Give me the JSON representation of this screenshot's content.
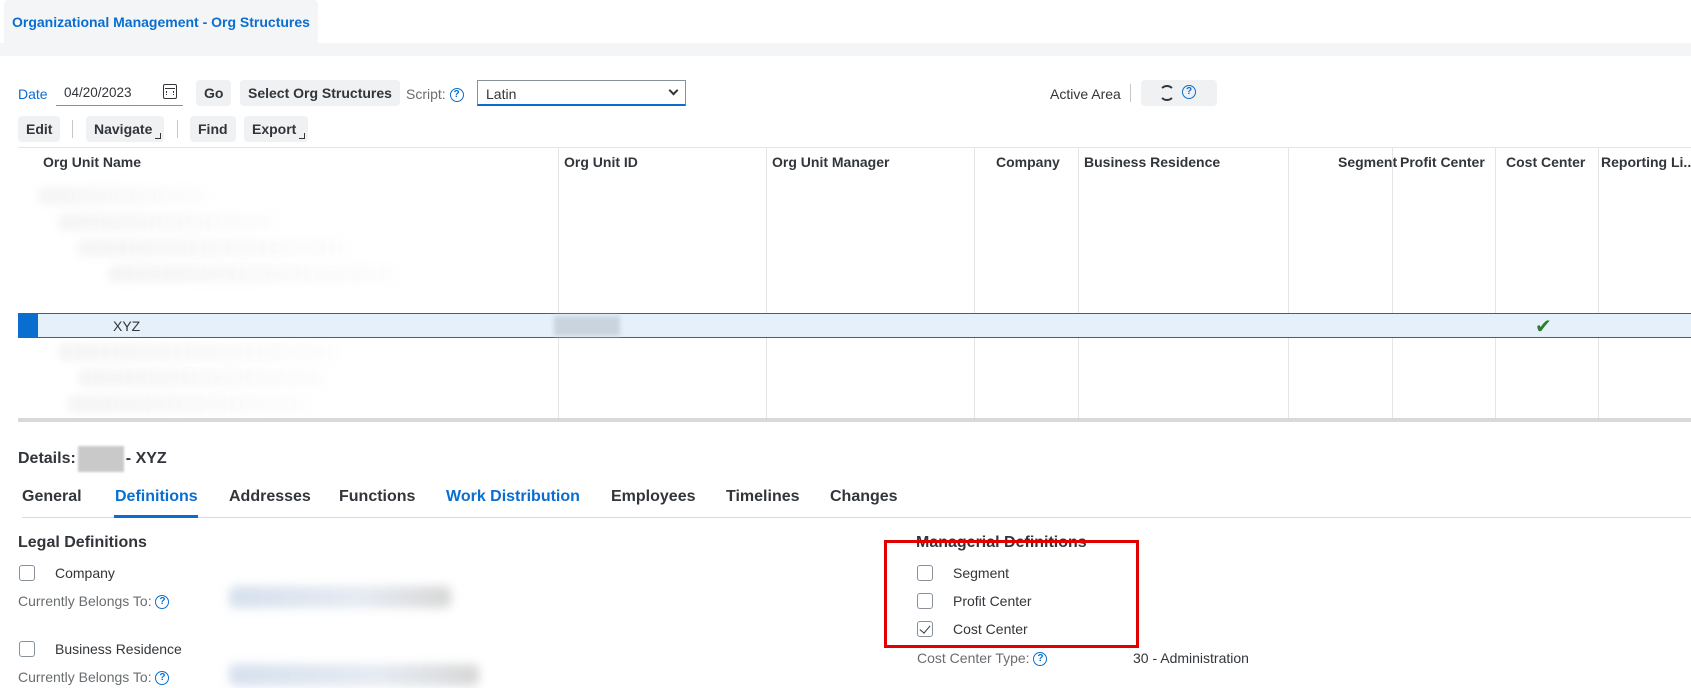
{
  "app": {
    "tab_title": "Organizational Management - Org Structures"
  },
  "toolbar": {
    "date_label": "Date",
    "date_value": "04/20/2023",
    "calendar_icon": "calendar-icon",
    "go_label": "Go",
    "select_org_label": "Select Org Structures",
    "script_label": "Script:",
    "script_value": "Latin",
    "active_area_label": "Active Area",
    "edit_label": "Edit",
    "navigate_label": "Navigate",
    "find_label": "Find",
    "export_label": "Export"
  },
  "grid": {
    "columns": [
      "Org Unit Name",
      "Org Unit ID",
      "Org Unit Manager",
      "Company",
      "Business Residence",
      "Segment",
      "Profit Center",
      "Cost Center",
      "Reporting Li..."
    ],
    "selected_row": {
      "name": "XYZ",
      "cost_center_checked": true
    }
  },
  "details": {
    "title_prefix": "Details:",
    "title_suffix": "- XYZ",
    "tabs": [
      "General",
      "Definitions",
      "Addresses",
      "Functions",
      "Work Distribution",
      "Employees",
      "Timelines",
      "Changes"
    ],
    "active_tab": "Definitions",
    "legal": {
      "title": "Legal Definitions",
      "company_label": "Company",
      "company_checked": false,
      "belongs_to_label": "Currently Belongs To:",
      "business_residence_label": "Business Residence",
      "business_residence_checked": false,
      "belongs_to_label_2": "Currently Belongs To:"
    },
    "managerial": {
      "title": "Managerial Definitions",
      "segment_label": "Segment",
      "segment_checked": false,
      "profit_center_label": "Profit Center",
      "profit_center_checked": false,
      "cost_center_label": "Cost Center",
      "cost_center_checked": true,
      "cost_center_type_label": "Cost Center Type:",
      "cost_center_type_value": "30 - Administration"
    }
  },
  "colors": {
    "accent": "#0a6ed1",
    "highlight_box": "#e10000",
    "check_green": "#2b7c2b"
  }
}
